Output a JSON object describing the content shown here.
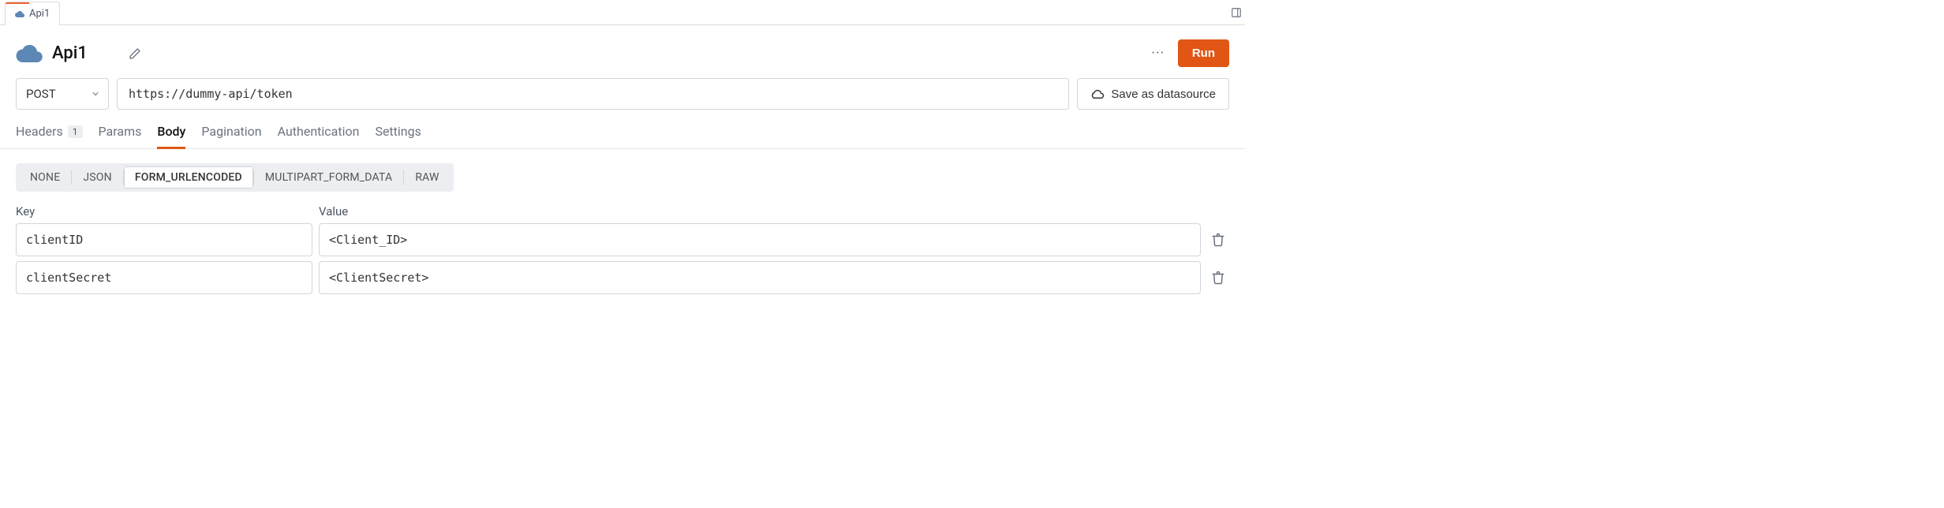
{
  "tab": {
    "label": "Api1"
  },
  "api": {
    "name": "Api1"
  },
  "actions": {
    "run": "Run",
    "save_datasource": "Save as datasource"
  },
  "request": {
    "method": "POST",
    "url": "https://dummy-api/token"
  },
  "subtabs": {
    "headers": {
      "label": "Headers",
      "count": "1"
    },
    "params": "Params",
    "body": "Body",
    "pagination": "Pagination",
    "authentication": "Authentication",
    "settings": "Settings",
    "active": "body"
  },
  "body_types": {
    "none": "NONE",
    "json": "JSON",
    "form_urlencoded": "FORM_URLENCODED",
    "multipart": "MULTIPART_FORM_DATA",
    "raw": "RAW",
    "active": "form_urlencoded"
  },
  "kv": {
    "key_header": "Key",
    "value_header": "Value",
    "rows": [
      {
        "key": "clientID",
        "value": "<Client_ID>"
      },
      {
        "key": "clientSecret",
        "value": "<ClientSecret>"
      }
    ]
  }
}
